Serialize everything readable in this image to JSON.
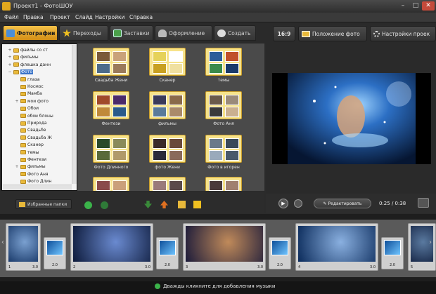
{
  "window": {
    "title": "Проект1 - ФотоШОУ"
  },
  "menu": [
    "Файл",
    "Правка",
    "Проект",
    "Слайд",
    "Настройки",
    "Справка"
  ],
  "tabs": [
    {
      "label": "Фотографии",
      "icon": "photos-icon"
    },
    {
      "label": "Переходы",
      "icon": "star-icon"
    },
    {
      "label": "Заставки",
      "icon": "screensaver-icon"
    },
    {
      "label": "Оформление",
      "icon": "design-icon"
    },
    {
      "label": "Создать",
      "icon": "create-icon"
    }
  ],
  "right_toolbar": {
    "aspect": "16:9",
    "photo_position": "Положение фото",
    "settings": "Настройки проек"
  },
  "tree": [
    {
      "label": "файлы со ст",
      "depth": 0,
      "exp": "+"
    },
    {
      "label": "фильмы",
      "depth": 0,
      "exp": "+"
    },
    {
      "label": "флешка данн",
      "depth": 0,
      "exp": "+"
    },
    {
      "label": "Фото",
      "depth": 0,
      "exp": "−",
      "selected": true
    },
    {
      "label": "глаза",
      "depth": 1,
      "exp": ""
    },
    {
      "label": "Космос",
      "depth": 1,
      "exp": ""
    },
    {
      "label": "Мамба",
      "depth": 1,
      "exp": ""
    },
    {
      "label": "мои фото",
      "depth": 1,
      "exp": "+"
    },
    {
      "label": "Обои",
      "depth": 1,
      "exp": ""
    },
    {
      "label": "обои блоны",
      "depth": 1,
      "exp": ""
    },
    {
      "label": "Природа",
      "depth": 1,
      "exp": ""
    },
    {
      "label": "Свадьбе",
      "depth": 1,
      "exp": ""
    },
    {
      "label": "Свадьба Ж",
      "depth": 1,
      "exp": ""
    },
    {
      "label": "Сканер",
      "depth": 1,
      "exp": ""
    },
    {
      "label": "темы",
      "depth": 1,
      "exp": ""
    },
    {
      "label": "Фентези",
      "depth": 1,
      "exp": ""
    },
    {
      "label": "фильмы",
      "depth": 1,
      "exp": "+"
    },
    {
      "label": "Фото Аня",
      "depth": 1,
      "exp": ""
    },
    {
      "label": "Фото Длин",
      "depth": 1,
      "exp": ""
    }
  ],
  "folders": [
    {
      "label": "Свадьба Жени",
      "colors": [
        "#7a5a3a",
        "#c9a27a",
        "#4d6b8a",
        "#9a7a5a"
      ]
    },
    {
      "label": "Сканер",
      "colors": [
        "#e6d25a",
        "#ffffff",
        "#c8a020",
        "#f0e0a0"
      ]
    },
    {
      "label": "темы",
      "colors": [
        "#2d5e9a",
        "#c0502a",
        "#3a8a4a",
        "#1a3a6a"
      ]
    },
    {
      "label": "Фентези",
      "colors": [
        "#a04a2a",
        "#4a2a6a",
        "#c08a3a",
        "#2a5a8a"
      ]
    },
    {
      "label": "фильмы",
      "colors": [
        "#3a3a5a",
        "#8a6a4a",
        "#5a7a9a",
        "#aa8a6a"
      ]
    },
    {
      "label": "Фото Аня",
      "colors": [
        "#6a5a4a",
        "#9a8a7a",
        "#3a3a3a",
        "#cab090"
      ]
    },
    {
      "label": "Фото Длинного",
      "colors": [
        "#2a4a2a",
        "#8a8a5a",
        "#5a6a3a",
        "#b09a6a"
      ]
    },
    {
      "label": "фото Жени",
      "colors": [
        "#3a2a2a",
        "#6a4a3a",
        "#2a2a3a",
        "#8a6a5a"
      ]
    },
    {
      "label": "Фото в игорен",
      "colors": [
        "#6a7a8a",
        "#3a4a5a",
        "#9aaabb",
        "#4a5a6a"
      ]
    },
    {
      "label": "",
      "colors": [
        "#8a4a4a",
        "#caa07a",
        "#6a3a3a",
        "#b08060"
      ]
    },
    {
      "label": "",
      "colors": [
        "#9a7a7a",
        "#5a4a4a",
        "#c0a0a0",
        "#7a5a5a"
      ]
    },
    {
      "label": "",
      "colors": [
        "#4a3a3a",
        "#a08070",
        "#6a5040",
        "#c8b098"
      ]
    }
  ],
  "favorites_button": "Избранные папки",
  "player": {
    "edit": "Редактировать",
    "time": "0:25 / 0:38"
  },
  "timeline": {
    "slides": [
      {
        "num": "1",
        "dur": "3.0",
        "colors": [
          "#1a3a6a",
          "#7aa0d0"
        ]
      },
      {
        "num": "2",
        "dur": "3.0",
        "colors": [
          "#0d1a3a",
          "#6a8ad0"
        ]
      },
      {
        "num": "3",
        "dur": "3.0",
        "colors": [
          "#1a1a3a",
          "#c08a5a"
        ]
      },
      {
        "num": "4",
        "dur": "3.0",
        "colors": [
          "#0a2a5a",
          "#8ab0e0"
        ]
      },
      {
        "num": "5",
        "dur": "",
        "colors": [
          "#1a2a4a",
          "#5a7aa0"
        ]
      }
    ],
    "transitions": [
      "2.0",
      "2.0",
      "2.0",
      "2.0"
    ]
  },
  "music_hint": "Дважды кликните для добавления музыки"
}
